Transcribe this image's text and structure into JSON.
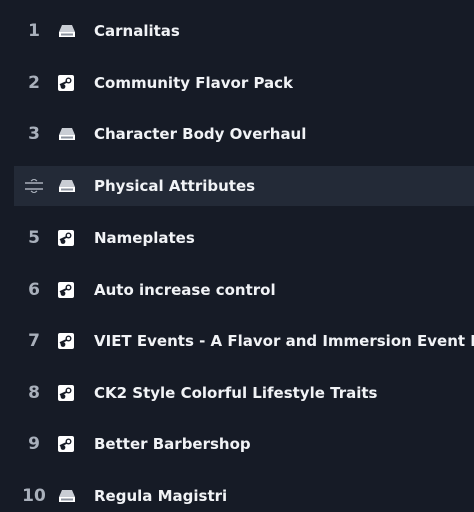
{
  "mods": [
    {
      "index": "1",
      "name": "Carnalitas",
      "source": "local-drive-icon"
    },
    {
      "index": "2",
      "name": "Community Flavor Pack",
      "source": "steam-icon"
    },
    {
      "index": "3",
      "name": "Character Body Overhaul",
      "source": "local-drive-icon"
    },
    {
      "index": "4",
      "name": "Physical Attributes",
      "source": "local-drive-icon",
      "hovered": true
    },
    {
      "index": "5",
      "name": "Nameplates",
      "source": "steam-icon"
    },
    {
      "index": "6",
      "name": "Auto increase control",
      "source": "steam-icon"
    },
    {
      "index": "7",
      "name": "VIET Events - A Flavor and Immersion Event Mod",
      "source": "steam-icon"
    },
    {
      "index": "8",
      "name": "CK2 Style Colorful Lifestyle Traits",
      "source": "steam-icon"
    },
    {
      "index": "9",
      "name": "Better Barbershop",
      "source": "steam-icon"
    },
    {
      "index": "10",
      "name": "Regula Magistri",
      "source": "local-drive-icon"
    }
  ]
}
